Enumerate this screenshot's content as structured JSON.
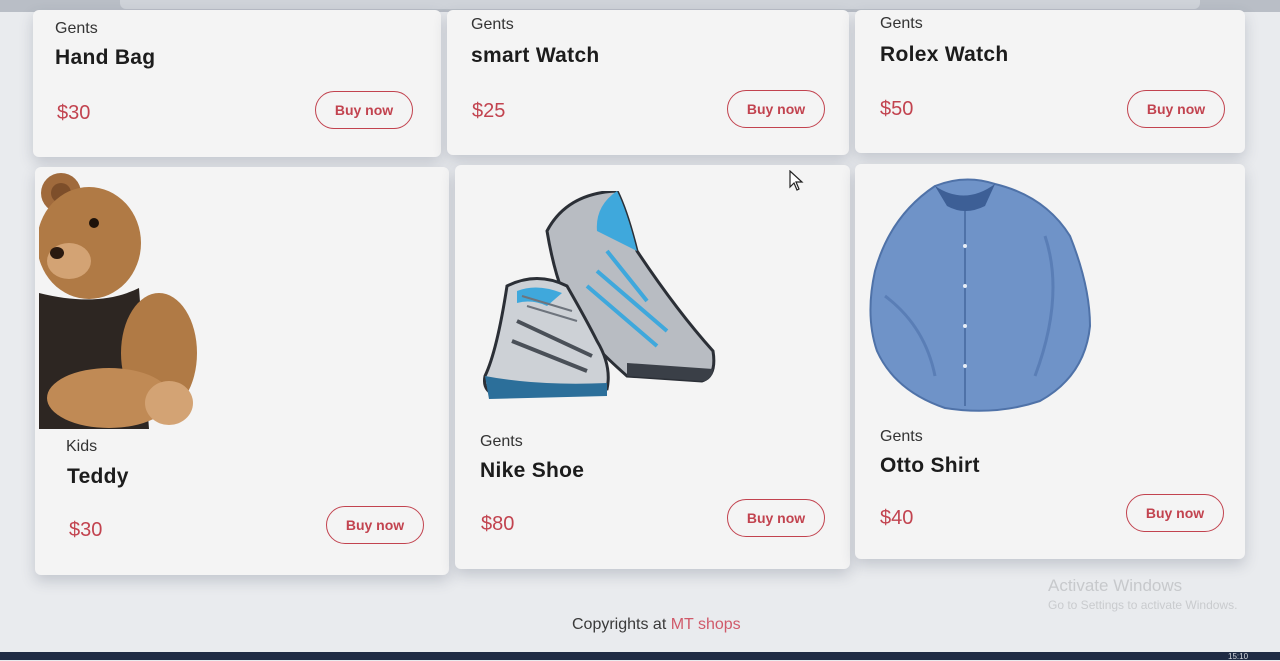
{
  "cards": [
    {
      "category": "Gents",
      "name": "Hand Bag",
      "price": "$30",
      "button": "Buy now"
    },
    {
      "category": "Gents",
      "name": "smart Watch",
      "price": "$25",
      "button": "Buy now"
    },
    {
      "category": "Gents",
      "name": "Rolex Watch",
      "price": "$50",
      "button": "Buy now"
    },
    {
      "category": "Kids",
      "name": "Teddy",
      "price": "$30",
      "button": "Buy now",
      "image": "teddy-bear"
    },
    {
      "category": "Gents",
      "name": "Nike Shoe",
      "price": "$80",
      "button": "Buy now",
      "image": "sneakers"
    },
    {
      "category": "Gents",
      "name": "Otto Shirt",
      "price": "$40",
      "button": "Buy now",
      "image": "blue-shirt"
    }
  ],
  "footer": {
    "prefix": "Copyrights at",
    "brand": "MT shops"
  },
  "watermark": {
    "line1": "Activate Windows",
    "line2": "Go to Settings to activate Windows."
  },
  "taskbar": {
    "clock": "15:10"
  },
  "colors": {
    "accent": "#c2434f",
    "background": "#e9ebee",
    "card": "#f4f4f4"
  }
}
